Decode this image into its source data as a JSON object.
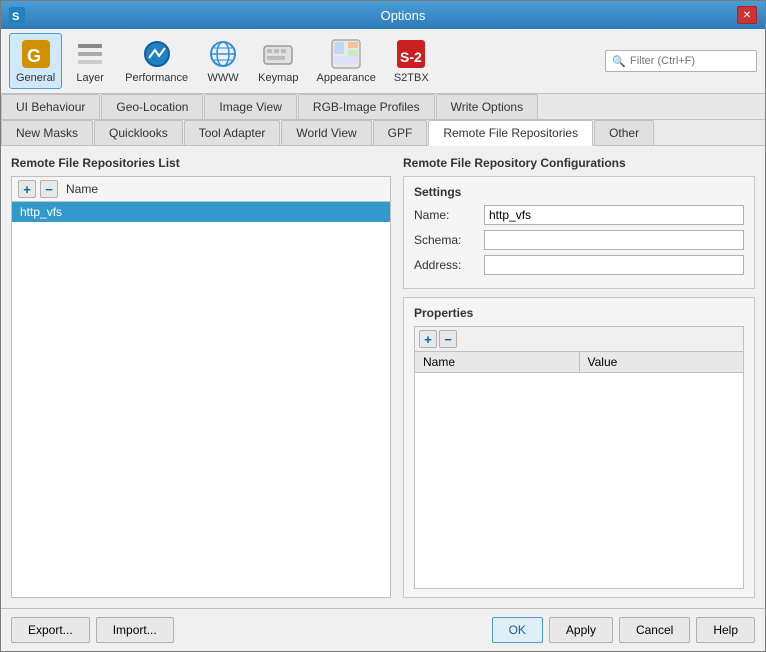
{
  "window": {
    "title": "Options",
    "close_btn": "✕"
  },
  "toolbar": {
    "icons": [
      {
        "id": "general",
        "label": "General",
        "icon": "⚙",
        "active": true
      },
      {
        "id": "layer",
        "label": "Layer",
        "icon": "🗂",
        "active": false
      },
      {
        "id": "performance",
        "label": "Performance",
        "icon": "📊",
        "active": false
      },
      {
        "id": "www",
        "label": "WWW",
        "icon": "🌐",
        "active": false
      },
      {
        "id": "keymap",
        "label": "Keymap",
        "icon": "⌨",
        "active": false
      },
      {
        "id": "appearance",
        "label": "Appearance",
        "icon": "🎨",
        "active": false
      },
      {
        "id": "s2tbx",
        "label": "S2TBX",
        "icon": "S",
        "active": false
      }
    ],
    "filter_placeholder": "Filter (Ctrl+F)"
  },
  "tabs_row1": [
    {
      "id": "ui-behaviour",
      "label": "UI Behaviour",
      "active": false
    },
    {
      "id": "geo-location",
      "label": "Geo-Location",
      "active": false
    },
    {
      "id": "image-view",
      "label": "Image View",
      "active": false
    },
    {
      "id": "rgb-image-profiles",
      "label": "RGB-Image Profiles",
      "active": false
    },
    {
      "id": "write-options",
      "label": "Write Options",
      "active": false
    }
  ],
  "tabs_row2": [
    {
      "id": "new-masks",
      "label": "New Masks",
      "active": false
    },
    {
      "id": "quicklooks",
      "label": "Quicklooks",
      "active": false
    },
    {
      "id": "tool-adapter",
      "label": "Tool Adapter",
      "active": false
    },
    {
      "id": "world-view",
      "label": "World View",
      "active": false
    },
    {
      "id": "gpf",
      "label": "GPF",
      "active": false
    },
    {
      "id": "remote-file-repos",
      "label": "Remote File Repositories",
      "active": true
    },
    {
      "id": "other",
      "label": "Other",
      "active": false
    }
  ],
  "left_panel": {
    "title": "Remote File Repositories List",
    "add_btn": "+",
    "remove_btn": "−",
    "col_name": "Name",
    "items": [
      {
        "id": "http_vfs",
        "label": "http_vfs",
        "selected": true
      }
    ]
  },
  "right_panel": {
    "title": "Remote File Repository Configurations",
    "settings": {
      "title": "Settings",
      "fields": [
        {
          "label": "Name:",
          "value": "http_vfs",
          "placeholder": ""
        },
        {
          "label": "Schema:",
          "value": "",
          "placeholder": ""
        },
        {
          "label": "Address:",
          "value": "",
          "placeholder": ""
        }
      ]
    },
    "properties": {
      "title": "Properties",
      "col_name": "Name",
      "col_value": "Value",
      "add_btn": "+",
      "remove_btn": "−",
      "items": []
    }
  },
  "bottom": {
    "export_label": "Export...",
    "import_label": "Import...",
    "ok_label": "OK",
    "apply_label": "Apply",
    "cancel_label": "Cancel",
    "help_label": "Help"
  }
}
